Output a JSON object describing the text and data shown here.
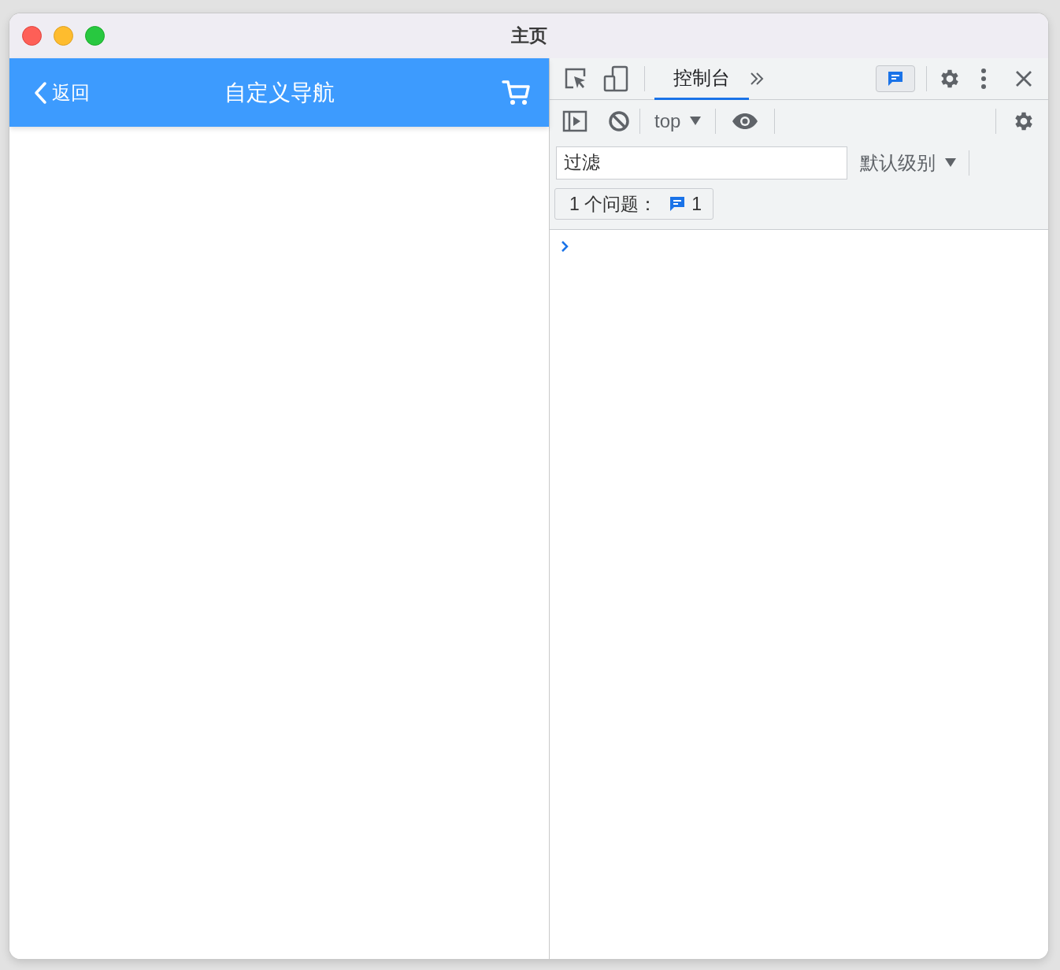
{
  "window": {
    "title": "主页"
  },
  "nav_bar": {
    "back": "返回",
    "title": "自定义导航"
  },
  "devtools": {
    "tabs": [
      {
        "label": "控制台",
        "selected": true
      }
    ],
    "context": "top",
    "filter": {
      "placeholder": "过滤"
    },
    "level_menu": "默认级别",
    "issues": {
      "label": "1 个问题：",
      "count": "1"
    }
  }
}
